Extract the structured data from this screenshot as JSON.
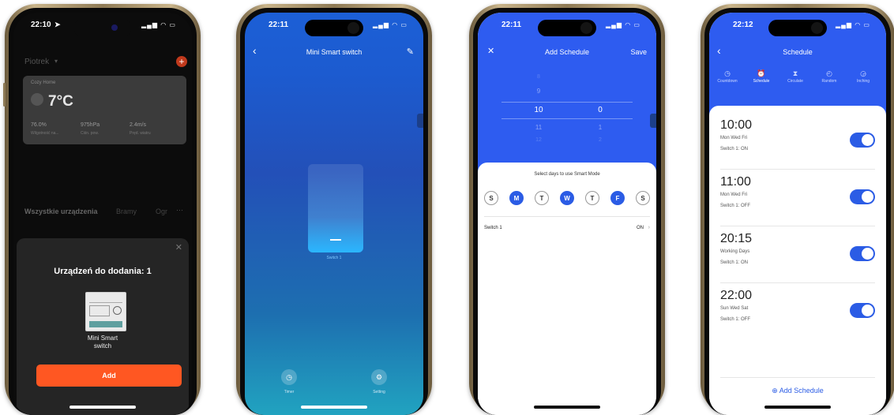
{
  "phone1": {
    "time": "22:10",
    "location_arrow": "location-arrow-icon",
    "account_name": "Piotrek",
    "weather": {
      "place": "Cozy Home",
      "temperature": "7°C",
      "humidity_value": "76.0%",
      "humidity_label": "Wilgotność na...",
      "pressure_value": "975hPa",
      "pressure_label": "Ciśn. pow.",
      "wind_value": "2.4m/s",
      "wind_label": "Pręd. wiatru"
    },
    "devices_tabs": [
      "Wszystkie urządzenia",
      "Bramy",
      "Ogr"
    ],
    "sheet_title": "Urządzeń do dodania: 1",
    "device_name_line1": "Mini Smart",
    "device_name_line2": "switch",
    "add_label": "Add",
    "accent_color": "#ff5722"
  },
  "phone2": {
    "time": "22:11",
    "title": "Mini Smart switch",
    "switch_label": "Switch 1",
    "timer_label": "Timer",
    "setting_label": "Setting"
  },
  "phone3": {
    "time": "22:11",
    "title": "Add Schedule",
    "save_label": "Save",
    "hours": [
      "8",
      "9",
      "10",
      "11",
      "12"
    ],
    "minutes": [
      "0",
      "1",
      "2"
    ],
    "days_prompt": "Select days to use Smart Mode",
    "days": [
      {
        "label": "S",
        "selected": false
      },
      {
        "label": "M",
        "selected": true
      },
      {
        "label": "T",
        "selected": false
      },
      {
        "label": "W",
        "selected": true
      },
      {
        "label": "T",
        "selected": false
      },
      {
        "label": "F",
        "selected": true
      },
      {
        "label": "S",
        "selected": false
      }
    ],
    "switch_row_label": "Switch 1",
    "switch_row_value": "ON",
    "accent_color": "#2e5cf0"
  },
  "phone4": {
    "time": "22:12",
    "title": "Schedule",
    "tabs": [
      "Countdown",
      "Schedule",
      "Circulate",
      "Random",
      "Inching"
    ],
    "active_tab": "Schedule",
    "schedules": [
      {
        "time": "10:00",
        "days": "Mon Wed Fri",
        "action": "Switch 1: ON",
        "enabled": true
      },
      {
        "time": "11:00",
        "days": "Mon Wed Fri",
        "action": "Switch 1: OFF",
        "enabled": true
      },
      {
        "time": "20:15",
        "days": "Working Days",
        "action": "Switch 1: ON",
        "enabled": true
      },
      {
        "time": "22:00",
        "days": "Sun Wed Sat",
        "action": "Switch 1: OFF",
        "enabled": true
      }
    ],
    "add_schedule_label": "Add Schedule",
    "accent_color": "#2b5ce5"
  }
}
